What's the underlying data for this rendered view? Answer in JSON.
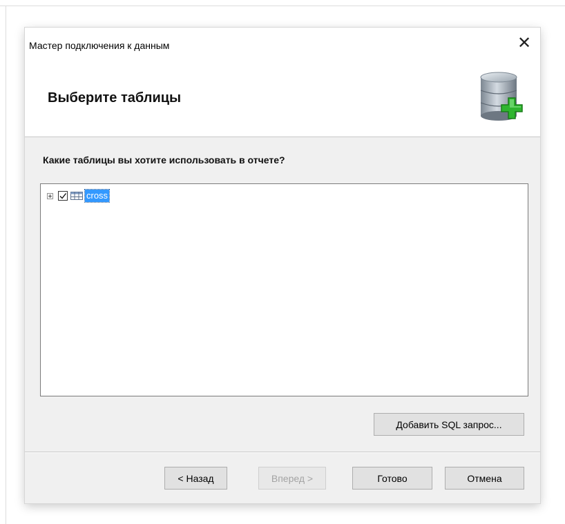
{
  "dialog": {
    "title": "Мастер подключения к данным",
    "close_glyph": "✕",
    "heading": "Выберите таблицы",
    "header_icon": "database-add-icon"
  },
  "content": {
    "question": "Какие таблицы вы хотите использовать в отчете?",
    "tree": {
      "items": [
        {
          "label": "cross",
          "checked": true,
          "expanded": false,
          "selected": true,
          "icon": "table-icon"
        }
      ]
    },
    "add_sql_button": "Добавить SQL запрос..."
  },
  "footer": {
    "back_button": "< Назад",
    "next_button": "Вперед >",
    "finish_button": "Готово",
    "cancel_button": "Отмена"
  },
  "colors": {
    "selection": "#3399ff",
    "accent_green": "#2fb52f",
    "dialog_bg": "#f0f0f0"
  }
}
